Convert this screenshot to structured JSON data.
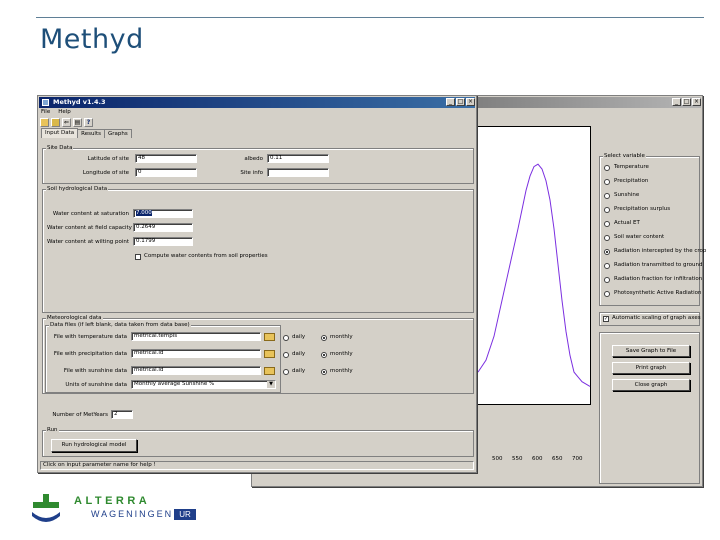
{
  "slide": {
    "title": "Methyd"
  },
  "main_window": {
    "title": "Methyd v1.4.3",
    "menu": [
      "File",
      "Help"
    ],
    "tabs": [
      "Input Data",
      "Results",
      "Graphs"
    ],
    "active_tab": "Input Data",
    "site_data": {
      "group_label": "Site Data",
      "latitude_label": "Latitude of site",
      "latitude_value": "48",
      "longitude_label": "Longitude of site",
      "longitude_value": "0",
      "albedo_label": "albedo",
      "albedo_value": "0.11",
      "site_info_label": "Site info",
      "site_info_value": ""
    },
    "soil": {
      "group_label": "Soil hydrological Data",
      "saturation_label": "Water content at saturation",
      "saturation_value": "7.000",
      "field_capacity_label": "Water content at field capacity",
      "field_capacity_value": "0.2649",
      "wilting_label": "Water content at wilting point",
      "wilting_value": "0.1799",
      "compute_label": "Compute water contents from soil properties"
    },
    "meteo": {
      "group_label": "Meteorological data",
      "sublabel": "Data files (if left blank, data taken from data base)",
      "temperature_label": "File with temperature data",
      "temperature_value": "metrical.tempis",
      "precip_label": "File with precipitation data",
      "precip_value": "metrical.ld",
      "sunshine_label": "File with sunshine data",
      "sunshine_value": "metrical.ld",
      "units_label": "Units of sunshine data",
      "units_value": "Monthly average Sunshine %",
      "daily": "daily",
      "monthly": "monthly"
    },
    "years_label": "Number of MetYears",
    "years_value": "2",
    "run": {
      "group_label": "Run",
      "button_label": "Run hydrological model"
    },
    "status": "Click on input parameter name for help !"
  },
  "graph_window": {
    "options_label": "Select variable",
    "options": [
      "Temperature",
      "Precipitation",
      "Sunshine",
      "Precipitation surplus",
      "Actual ET",
      "Soil water content",
      "Radiation intercepted by the crop",
      "Radiation transmitted to ground",
      "Radiation fraction for infiltration",
      "Photosynthetic Active Radiation"
    ],
    "selected_option": 6,
    "autoscale_label": "Automatic scaling of graph axes",
    "buttons": [
      "Save Graph to File",
      "Print graph",
      "Close graph"
    ]
  },
  "chart_data": {
    "type": "line",
    "x": [
      450,
      470,
      490,
      510,
      530,
      550,
      560,
      570,
      580,
      590,
      600,
      610,
      620,
      630,
      640,
      650,
      660,
      670,
      680,
      690,
      700,
      710,
      720,
      730
    ],
    "series": [
      {
        "values": [
          0.1,
          0.15,
          0.25,
          0.4,
          0.55,
          0.7,
          0.78,
          0.86,
          0.92,
          0.96,
          0.97,
          0.95,
          0.9,
          0.82,
          0.7,
          0.55,
          0.4,
          0.27,
          0.17,
          0.1,
          0.08,
          0.06,
          0.05,
          0.04
        ]
      }
    ],
    "x_ticks": [
      "500",
      "550",
      "600",
      "650",
      "700"
    ],
    "color": "#7b2fe0"
  },
  "logo": {
    "line1": "ALTERRA",
    "line2": "WAGENINGEN",
    "line2_box": "UR"
  }
}
